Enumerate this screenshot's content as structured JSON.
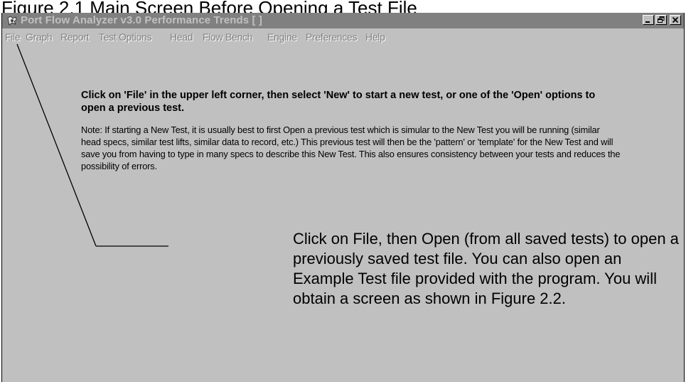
{
  "figure": {
    "caption": "Figure 2.1  Main Screen Before Opening a Test File"
  },
  "window": {
    "title": "Port Flow Analyzer v3.0   Performance Trends   [  ]",
    "icon": "app-icon",
    "buttons": {
      "minimize": "_",
      "restore": "restore-icon",
      "close": "close-icon"
    }
  },
  "menu": {
    "items": [
      {
        "label": "File"
      },
      {
        "label": "Graph"
      },
      {
        "label": "Report"
      },
      {
        "label": "Test Options"
      },
      {
        "label": "Head"
      },
      {
        "label": "Flow Bench"
      },
      {
        "label": "Engine"
      },
      {
        "label": "Preferences"
      },
      {
        "label": "Help"
      }
    ]
  },
  "main": {
    "instruction": "Click on 'File' in the upper left corner, then select 'New' to start a new test, or one of the 'Open' options to open a previous test.",
    "note": "Note:  If starting a New Test, it is usually best to first Open a previous test which is simular to the New Test you will be running (similar head specs, similar test lifts, similar data to record, etc.)  This previous test will then be the 'pattern' or 'template' for the New Test and will save you from having to type in many specs to describe this New Test.  This also ensures consistency between your tests and reduces the possibility of errors."
  },
  "annotation": {
    "callout": "Click on File, then Open (from all saved tests) to open a previously saved test file.  You can also open an Example Test file provided with the program.  You will obtain a screen as shown in Figure 2.2."
  },
  "colors": {
    "window_bg": "#c0c0c0",
    "titlebar_bg": "#808080",
    "titlebar_text": "#c0c0c0",
    "menu_text_disabled": "#808080"
  }
}
